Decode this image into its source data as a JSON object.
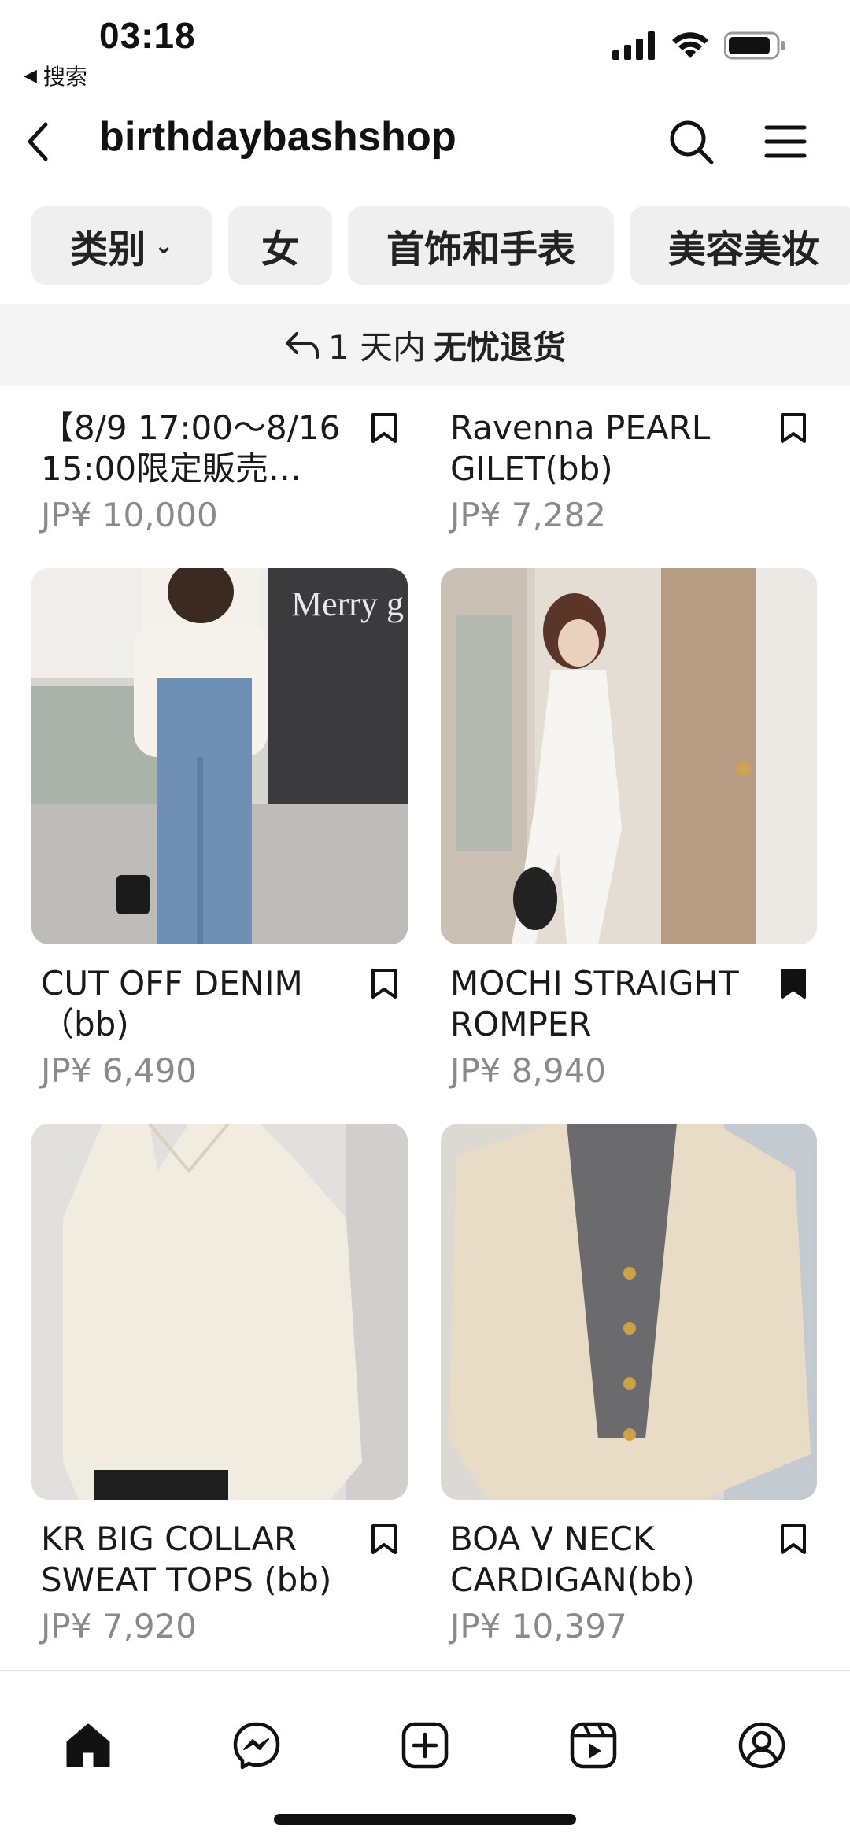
{
  "status_bar": {
    "time": "03:18",
    "back_app": "搜索"
  },
  "header": {
    "title": "birthdaybashshop"
  },
  "chips": [
    {
      "label": "类别"
    },
    {
      "label": "女"
    },
    {
      "label": "首饰和手表"
    },
    {
      "label": "美容美妆"
    }
  ],
  "banner": {
    "prefix": "1 天内",
    "bold": "无忧退货"
  },
  "products": [
    {
      "name": "【8/9 17:00～8/16 15:00限定販売…",
      "price": "JP¥ 10,000",
      "saved": false
    },
    {
      "name": "Ravenna PEARL GILET(bb)",
      "price": "JP¥ 7,282",
      "saved": false
    },
    {
      "name": "CUT OFF DENIM （bb)",
      "price": "JP¥ 6,490",
      "saved": false
    },
    {
      "name": "MOCHI STRAIGHT ROMPER",
      "price": "JP¥ 8,940",
      "saved": true
    },
    {
      "name": "KR BIG COLLAR SWEAT TOPS (bb)",
      "price": "JP¥ 7,920",
      "saved": false
    },
    {
      "name": "BOA V NECK CARDIGAN(bb)",
      "price": "JP¥ 10,397",
      "saved": false
    }
  ],
  "icons": {
    "header": [
      "back-arrow-icon",
      "search-icon",
      "menu-icon"
    ],
    "nav": [
      "home-icon",
      "messenger-icon",
      "create-icon",
      "reels-icon",
      "profile-icon"
    ]
  },
  "colors": {
    "chip_bg": "#efefef",
    "banner_bg": "#f4f4f4",
    "price": "#8a8a8a"
  }
}
